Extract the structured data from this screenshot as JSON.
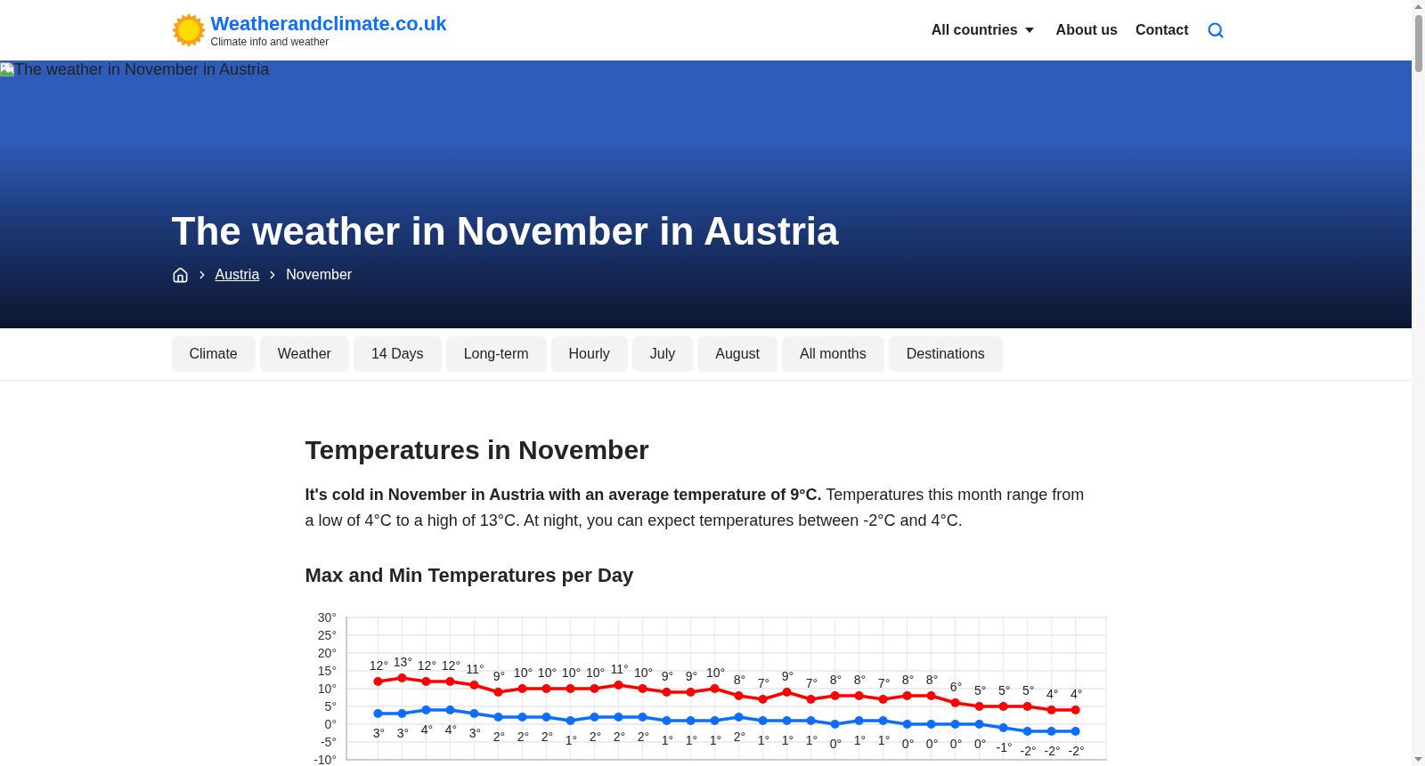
{
  "header": {
    "site_name": "Weatherandclimate.co.uk",
    "tagline": "Climate info and weather",
    "nav": [
      {
        "label": "All countries",
        "kind": "dropdown"
      },
      {
        "label": "About us",
        "kind": "link"
      },
      {
        "label": "Contact",
        "kind": "link"
      }
    ]
  },
  "hero": {
    "image_alt": "The weather in November in Austria",
    "title": "The weather in November in Austria",
    "breadcrumb": [
      {
        "kind": "home"
      },
      {
        "kind": "link",
        "label": "Austria"
      },
      {
        "kind": "current",
        "label": "November"
      }
    ]
  },
  "tabs": [
    {
      "label": "Climate"
    },
    {
      "label": "Weather"
    },
    {
      "label": "14 Days"
    },
    {
      "label": "Long-term"
    },
    {
      "label": "Hourly"
    },
    {
      "label": "July"
    },
    {
      "label": "August"
    },
    {
      "label": "All months"
    },
    {
      "label": "Destinations"
    }
  ],
  "content": {
    "heading": "Temperatures in November",
    "intro": "**It's cold in November in Austria with an average temperature of 9°C.** Temperatures this month range from a low of 4°C to a high of 13°C. At night, you can expect temperatures between -2°C and 4°C.",
    "chart_heading": "Max and Min Temperatures per Day",
    "chart_data": {
      "type": "line",
      "grid": true,
      "ylim": [
        -10,
        30
      ],
      "yticks": [
        {
          "value": 30,
          "label": "30°"
        },
        {
          "value": 25,
          "label": "25°"
        },
        {
          "value": 20,
          "label": "20°"
        },
        {
          "value": 15,
          "label": "15°"
        },
        {
          "value": 10,
          "label": "10°"
        },
        {
          "value": 5,
          "label": "5°"
        },
        {
          "value": 0,
          "label": "0°"
        },
        {
          "value": -5,
          "label": "-5°"
        },
        {
          "value": -10,
          "label": "-10°"
        }
      ],
      "series": [
        {
          "color": "#ff0000",
          "marker": true,
          "values": [
            12,
            13,
            12,
            12,
            11,
            9,
            10,
            10,
            10,
            10,
            11,
            10,
            9,
            9,
            10,
            8,
            7,
            9,
            7,
            8,
            8,
            7,
            8,
            8,
            6,
            5,
            5,
            5,
            4,
            4
          ]
        },
        {
          "color": "#0d6efd",
          "marker": true,
          "values": [
            3,
            3,
            4,
            4,
            3,
            2,
            2,
            2,
            1,
            2,
            2,
            2,
            1,
            1,
            1,
            2,
            1,
            1,
            1,
            0,
            1,
            1,
            0,
            0,
            0,
            0,
            -1,
            -2,
            -2,
            -2
          ]
        }
      ],
      "value_labels": [
        [
          "12°",
          "13°",
          "12°",
          "12°",
          "11°",
          "9°",
          "10°",
          "10°",
          "10°",
          "10°",
          "11°",
          "10°",
          "9°",
          "9°",
          "10°",
          "8°",
          "7°",
          "9°",
          "7°",
          "8°",
          "8°",
          "7°",
          "8°",
          "8°",
          "6°",
          "5°",
          "5°",
          "5°",
          "4°",
          "4°"
        ],
        [
          "3°",
          "3°",
          "4°",
          "4°",
          "3°",
          "2°",
          "2°",
          "2°",
          "1°",
          "2°",
          "2°",
          "2°",
          "1°",
          "1°",
          "1°",
          "2°",
          "1°",
          "1°",
          "1°",
          "0°",
          "1°",
          "1°",
          "0°",
          "0°",
          "0°",
          "0°",
          "-1°",
          "-2°",
          "-2°",
          "-2°"
        ]
      ]
    }
  }
}
